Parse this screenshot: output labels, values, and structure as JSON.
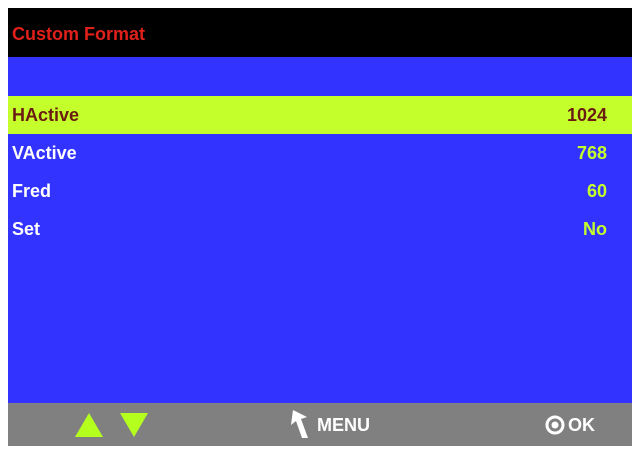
{
  "header": {
    "title": "Custom Format"
  },
  "menu": {
    "items": [
      {
        "label": "HActive",
        "value": "1024",
        "selected": true
      },
      {
        "label": "VActive",
        "value": "768",
        "selected": false
      },
      {
        "label": "Fred",
        "value": "60",
        "selected": false
      },
      {
        "label": "Set",
        "value": "No",
        "selected": false
      }
    ]
  },
  "footer": {
    "up_icon": "up-arrow-icon",
    "down_icon": "down-arrow-icon",
    "back_icon": "back-arrow-icon",
    "menu_label": "MENU",
    "ok_icon": "ok-circle-icon",
    "ok_label": "OK"
  },
  "colors": {
    "screen_background": "#3333ff",
    "title_bar_background": "#000000",
    "title_text": "#e0201a",
    "selected_row_background": "#c4ff2b",
    "selected_row_text": "#6b1c12",
    "value_text": "#c4ff2b",
    "label_text": "#ffffff",
    "footer_background": "#808080",
    "arrow_icons": "#b5ff1e"
  }
}
